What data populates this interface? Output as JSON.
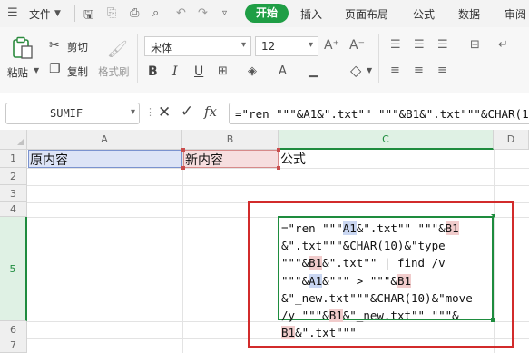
{
  "menubar": {
    "file_label": "文件",
    "tabs": [
      "开始",
      "插入",
      "页面布局",
      "公式",
      "数据",
      "审阅"
    ]
  },
  "ribbon": {
    "paste_label": "粘贴",
    "cut_label": "剪切",
    "copy_label": "复制",
    "format_painter_label": "格式刷",
    "font_name": "宋体",
    "font_size": "12",
    "grow_font": "A⁺",
    "shrink_font": "A⁻"
  },
  "formula_bar": {
    "name_box": "SUMIF",
    "fx_label": "fx",
    "content": "=\"ren \"\"\"&A1&\".txt\"\" \"\"\"&B1&\".txt\"\"\"&CHAR(10)&\"type \"\"\"&B1&\".txt\"\" | find /v \"\"\"&A1&\"\"\" > \"\"\"&B1&\"_new.txt\"\"\"&CHAR(10)&\"move /y \"\"\"&B1&\"_new.txt\"\" \"\"\"&B1&\".txt\"\"\""
  },
  "sheet": {
    "columns": [
      "A",
      "B",
      "C",
      "D"
    ],
    "rows": [
      "1",
      "2",
      "3",
      "4",
      "5",
      "6",
      "7"
    ],
    "cells": {
      "A1": "原内容",
      "B1": "新内容",
      "C1": "公式"
    },
    "formula_lines": [
      [
        [
          "t",
          "=\"ren \"\"\""
        ],
        [
          "a",
          "A1"
        ],
        [
          "t",
          "&\".txt\"\" \"\"\"&"
        ],
        [
          "b",
          "B1"
        ]
      ],
      [
        [
          "t",
          "&\".txt\"\"\"&CHAR(10)&\"type"
        ]
      ],
      [
        [
          "t",
          "\"\"\"&"
        ],
        [
          "b",
          "B1"
        ],
        [
          "t",
          "&\".txt\"\" | find /v"
        ]
      ],
      [
        [
          "t",
          "\"\"\"&"
        ],
        [
          "a",
          "A1"
        ],
        [
          "t",
          "&\"\"\" > \"\"\"&"
        ],
        [
          "b",
          "B1"
        ]
      ],
      [
        [
          "t",
          "&\"_new.txt\"\"\"&CHAR(10)&\"move"
        ]
      ],
      [
        [
          "t",
          "/y \"\"\"&"
        ],
        [
          "b",
          "B1"
        ],
        [
          "t",
          "&\"_new.txt\"\" \"\"\"&"
        ]
      ],
      [
        [
          "b",
          "B1"
        ],
        [
          "t",
          "&\".txt\"\"\""
        ]
      ]
    ]
  },
  "colors": {
    "accent": "#1e8c3e",
    "start_tab": "#1f9e45",
    "callout": "#d22b2b",
    "ref_a": "#c9d6f1",
    "ref_b": "#f1cccc"
  }
}
